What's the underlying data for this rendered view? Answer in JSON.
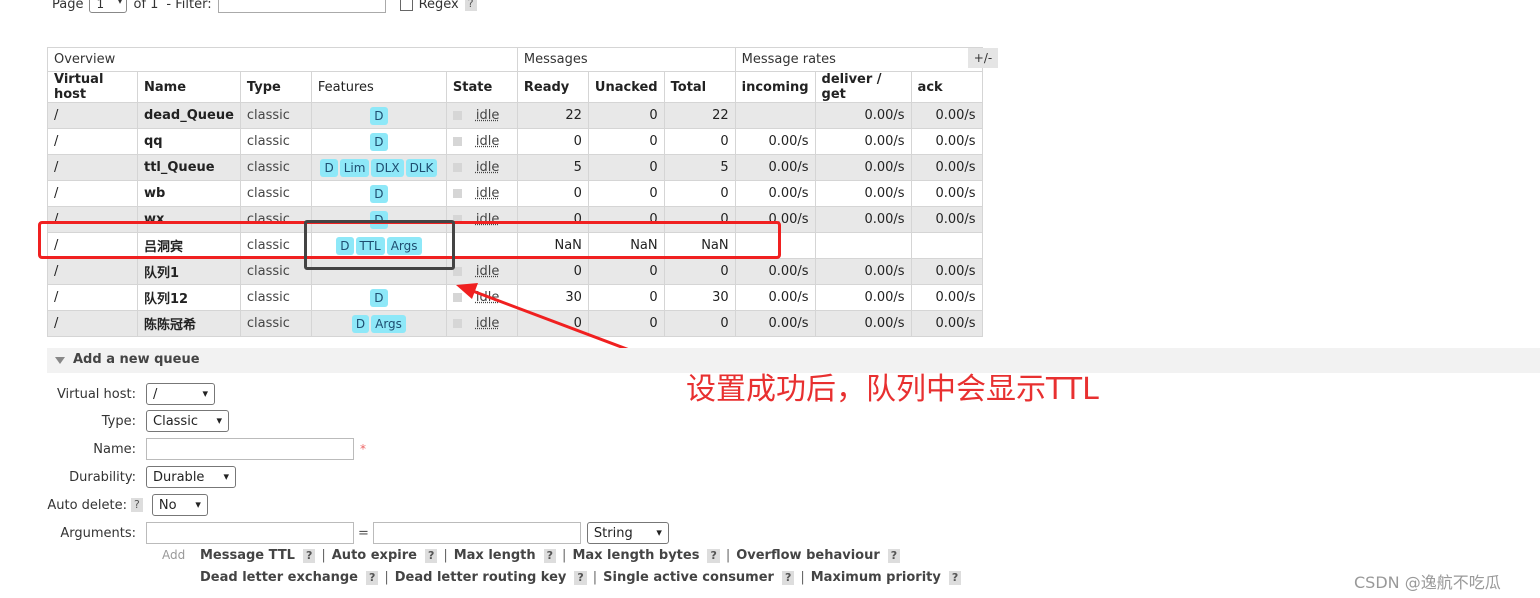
{
  "pager": {
    "page_label": "Page",
    "page_value": "1",
    "of_label": "of 1",
    "filter_label": "- Filter:",
    "regex_label": "Regex",
    "help": "?"
  },
  "table": {
    "groups": [
      "Overview",
      "Messages",
      "Message rates"
    ],
    "columns": [
      "Virtual host",
      "Name",
      "Type",
      "Features",
      "State",
      "Ready",
      "Unacked",
      "Total",
      "incoming",
      "deliver / get",
      "ack"
    ],
    "toggle_label": "+/-",
    "rows": [
      {
        "vhost": "/",
        "name": "dead_Queue",
        "type": "classic",
        "features": [
          "D"
        ],
        "state": "idle",
        "ready": "22",
        "unacked": "0",
        "total": "22",
        "incoming": "",
        "deliver": "0.00/s",
        "ack": "0.00/s"
      },
      {
        "vhost": "/",
        "name": "qq",
        "type": "classic",
        "features": [
          "D"
        ],
        "state": "idle",
        "ready": "0",
        "unacked": "0",
        "total": "0",
        "incoming": "0.00/s",
        "deliver": "0.00/s",
        "ack": "0.00/s"
      },
      {
        "vhost": "/",
        "name": "ttl_Queue",
        "type": "classic",
        "features": [
          "D",
          "Lim",
          "DLX",
          "DLK"
        ],
        "state": "idle",
        "ready": "5",
        "unacked": "0",
        "total": "5",
        "incoming": "0.00/s",
        "deliver": "0.00/s",
        "ack": "0.00/s"
      },
      {
        "vhost": "/",
        "name": "wb",
        "type": "classic",
        "features": [
          "D"
        ],
        "state": "idle",
        "ready": "0",
        "unacked": "0",
        "total": "0",
        "incoming": "0.00/s",
        "deliver": "0.00/s",
        "ack": "0.00/s"
      },
      {
        "vhost": "/",
        "name": "wx",
        "type": "classic",
        "features": [
          "D"
        ],
        "state": "idle",
        "ready": "0",
        "unacked": "0",
        "total": "0",
        "incoming": "0.00/s",
        "deliver": "0.00/s",
        "ack": "0.00/s"
      },
      {
        "vhost": "/",
        "name": "吕洞宾",
        "type": "classic",
        "features": [
          "D",
          "TTL",
          "Args"
        ],
        "state": "",
        "ready": "NaN",
        "unacked": "NaN",
        "total": "NaN",
        "incoming": "",
        "deliver": "",
        "ack": ""
      },
      {
        "vhost": "/",
        "name": "队列1",
        "type": "classic",
        "features": [],
        "state": "idle",
        "ready": "0",
        "unacked": "0",
        "total": "0",
        "incoming": "0.00/s",
        "deliver": "0.00/s",
        "ack": "0.00/s"
      },
      {
        "vhost": "/",
        "name": "队列12",
        "type": "classic",
        "features": [
          "D"
        ],
        "state": "idle",
        "ready": "30",
        "unacked": "0",
        "total": "30",
        "incoming": "0.00/s",
        "deliver": "0.00/s",
        "ack": "0.00/s"
      },
      {
        "vhost": "/",
        "name": "陈陈冠希",
        "type": "classic",
        "features": [
          "D",
          "Args"
        ],
        "state": "idle",
        "ready": "0",
        "unacked": "0",
        "total": "0",
        "incoming": "0.00/s",
        "deliver": "0.00/s",
        "ack": "0.00/s"
      }
    ]
  },
  "annotation": {
    "note": "设置成功后，队列中会显示TTL",
    "highlight_color": "#f02020",
    "box_color": "#444444"
  },
  "add_queue": {
    "title": "Add a new queue",
    "virtual_host_label": "Virtual host:",
    "virtual_host_value": "/",
    "type_label": "Type:",
    "type_value": "Classic",
    "name_label": "Name:",
    "name_required": "*",
    "durability_label": "Durability:",
    "durability_value": "Durable",
    "auto_delete_label": "Auto delete:",
    "auto_delete_value": "No",
    "arguments_label": "Arguments:",
    "equals": "=",
    "arg_type_value": "String",
    "add_label": "Add",
    "arg_shortcuts_1": [
      "Message TTL",
      "Auto expire",
      "Max length",
      "Max length bytes",
      "Overflow behaviour"
    ],
    "arg_shortcuts_2": [
      "Dead letter exchange",
      "Dead letter routing key",
      "Single active consumer",
      "Maximum priority"
    ]
  },
  "watermark": "CSDN @逸航不吃瓜",
  "colors": {
    "badge_bg": "#8ee8f8",
    "alt_row": "#e8e8e8"
  }
}
